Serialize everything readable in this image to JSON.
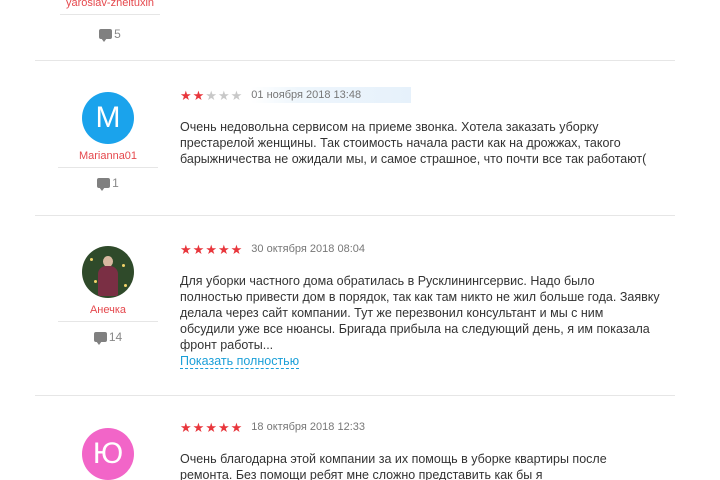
{
  "top_review": {
    "author": "yaroslav-zheltuxin",
    "comments": "5"
  },
  "reviews": [
    {
      "author": "Marianna01",
      "avatar_letter": "M",
      "avatar_color": "#1aa3ec",
      "rating": 2,
      "date": "01 ноября 2018 13:48",
      "text": "Очень недовольна сервисом на приеме звонка. Хотела заказать уборку престарелой женщины. Так стоимость начала расти как на дрожжах, такого барыжничества не ожидали мы, и самое страшное, что почти все так работают(",
      "comments": "1"
    },
    {
      "author": "Анечка",
      "avatar_letter": "",
      "rating": 5,
      "date": "30 октября 2018 08:04",
      "text": "Для уборки частного дома обратилась в Русклинингсервис. Надо было полностью привести дом в порядок, так как там никто не жил больше года. Заявку делала через сайт компании. Тут же перезвонил консультант и мы с ним обсудили уже все нюансы. Бригада прибыла на следующий день, я им показала фронт работы...",
      "more_link": "Показать полностью",
      "comments": "14"
    },
    {
      "author": "",
      "avatar_letter": "Ю",
      "avatar_color": "#f265c8",
      "rating": 5,
      "date": "18 октября 2018 12:33",
      "text": "Очень благодарна этой компании за их помощь в уборке квартиры после ремонта. Без помощи ребят мне сложно представить как бы я"
    }
  ],
  "colors": {
    "star_active": "#e8363c",
    "star_inactive": "#c8c8c8",
    "author_name": "#e5484d",
    "link": "#1a9fd8"
  },
  "icons": {
    "comments": "speech-bubble-icon",
    "rating": "star-icon"
  }
}
